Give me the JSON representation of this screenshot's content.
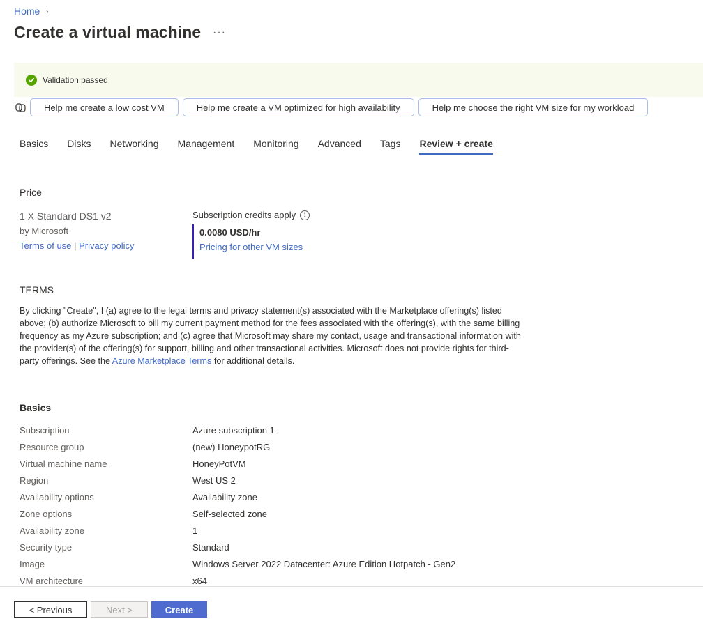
{
  "breadcrumb": {
    "home": "Home",
    "chevron": "›"
  },
  "page": {
    "title": "Create a virtual machine",
    "more": "···"
  },
  "banner": {
    "text": "Validation passed"
  },
  "copilot": {
    "icon": "copilot-icon",
    "suggestions": [
      "Help me create a low cost VM",
      "Help me create a VM optimized for high availability",
      "Help me choose the right VM size for my workload"
    ]
  },
  "tabs": [
    "Basics",
    "Disks",
    "Networking",
    "Management",
    "Monitoring",
    "Advanced",
    "Tags",
    "Review + create"
  ],
  "active_tab": "Review + create",
  "price": {
    "heading": "Price",
    "sku": "1 X Standard DS1 v2",
    "publisher": "by Microsoft",
    "terms_link": "Terms of use",
    "separator": "|",
    "privacy_link": "Privacy policy",
    "credits": "Subscription credits apply",
    "value": "0.0080 USD/hr",
    "other_sizes_link": "Pricing for other VM sizes"
  },
  "terms": {
    "heading": "TERMS",
    "body_before": "By clicking \"Create\", I (a) agree to the legal terms and privacy statement(s) associated with the Marketplace offering(s) listed above; (b) authorize Microsoft to bill my current payment method for the fees associated with the offering(s), with the same billing frequency as my Azure subscription; and (c) agree that Microsoft may share my contact, usage and transactional information with the provider(s) of the offering(s) for support, billing and other transactional activities. Microsoft does not provide rights for third-party offerings. See the ",
    "link": "Azure Marketplace Terms",
    "body_after": " for additional details."
  },
  "basics": {
    "heading": "Basics",
    "rows": [
      {
        "key": "Subscription",
        "value": "Azure subscription 1"
      },
      {
        "key": "Resource group",
        "value": "(new) HoneypotRG"
      },
      {
        "key": "Virtual machine name",
        "value": "HoneyPotVM"
      },
      {
        "key": "Region",
        "value": "West US 2"
      },
      {
        "key": "Availability options",
        "value": "Availability zone"
      },
      {
        "key": "Zone options",
        "value": "Self-selected zone"
      },
      {
        "key": "Availability zone",
        "value": "1"
      },
      {
        "key": "Security type",
        "value": "Standard"
      },
      {
        "key": "Image",
        "value": "Windows Server 2022 Datacenter: Azure Edition Hotpatch - Gen2"
      },
      {
        "key": "VM architecture",
        "value": "x64"
      }
    ]
  },
  "footer": {
    "previous": "< Previous",
    "next": "Next >",
    "create": "Create"
  },
  "colors": {
    "accent": "#3f6ac4",
    "create_button": "#4f6bd0",
    "success": "#57a300",
    "banner_bg": "#f7faec"
  }
}
